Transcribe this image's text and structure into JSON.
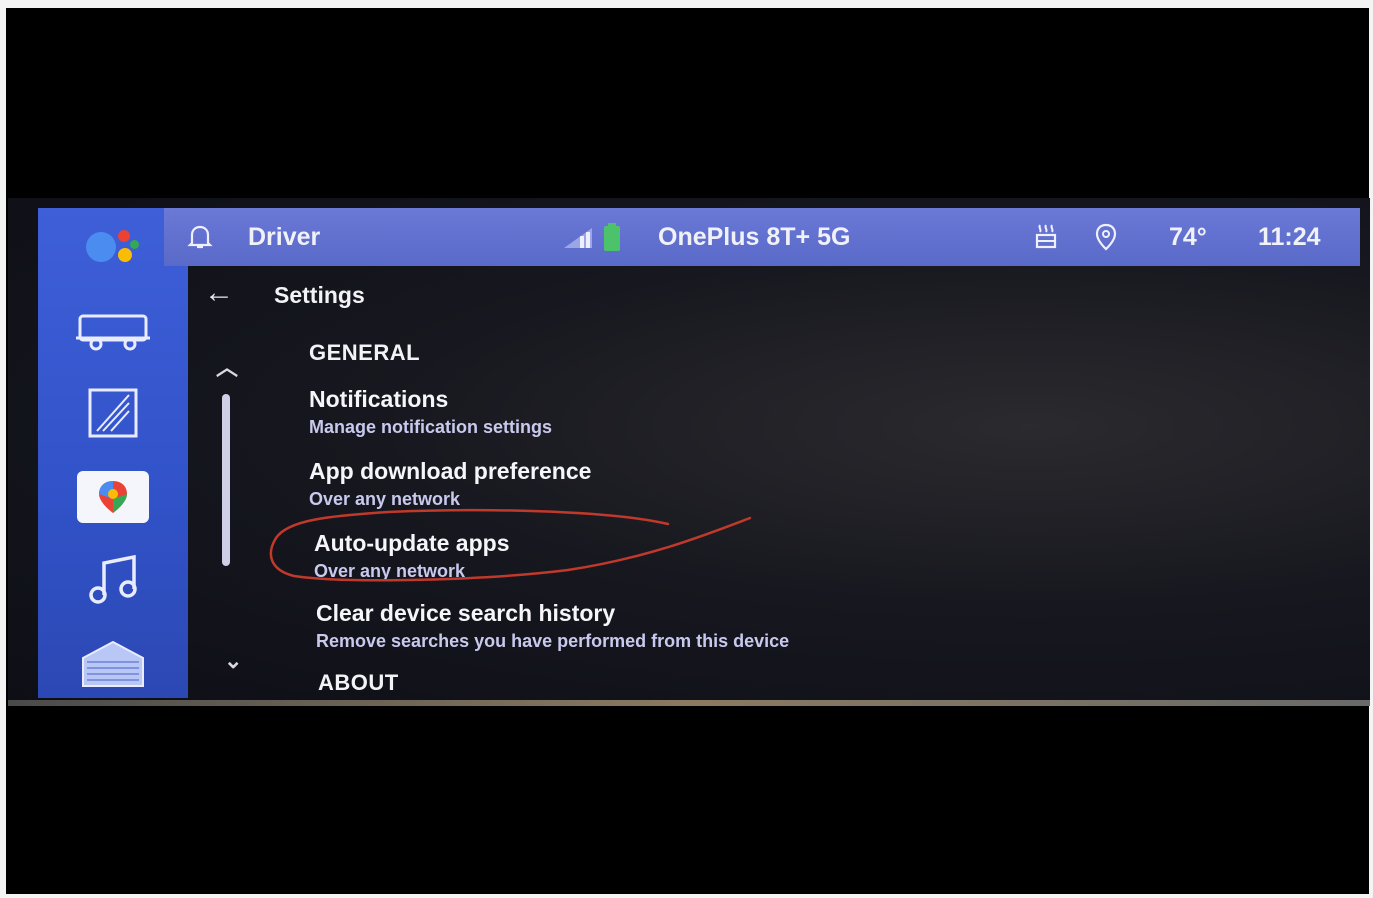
{
  "statusbar": {
    "profile_label": "Driver",
    "device_name": "OnePlus 8T+ 5G",
    "temperature": "74°",
    "time": "11:24"
  },
  "page": {
    "title": "Settings"
  },
  "sections": {
    "general": "GENERAL",
    "about": "ABOUT"
  },
  "items": [
    {
      "title": "Notifications",
      "subtitle": "Manage notification settings"
    },
    {
      "title": "App download preference",
      "subtitle": "Over any network"
    },
    {
      "title": "Auto-update apps",
      "subtitle": "Over any network"
    },
    {
      "title": "Clear device search history",
      "subtitle": "Remove searches you have performed from this device"
    }
  ],
  "rail": {
    "icons": [
      "google-assistant-icon",
      "car-icon",
      "media-card-icon",
      "maps-icon",
      "music-icon",
      "apps-grid-icon"
    ]
  },
  "colors": {
    "rail": "#3e5fd8",
    "statusbar": "#6a78d6",
    "annotation": "#c0392b",
    "subtitle": "#c9c9ee"
  }
}
